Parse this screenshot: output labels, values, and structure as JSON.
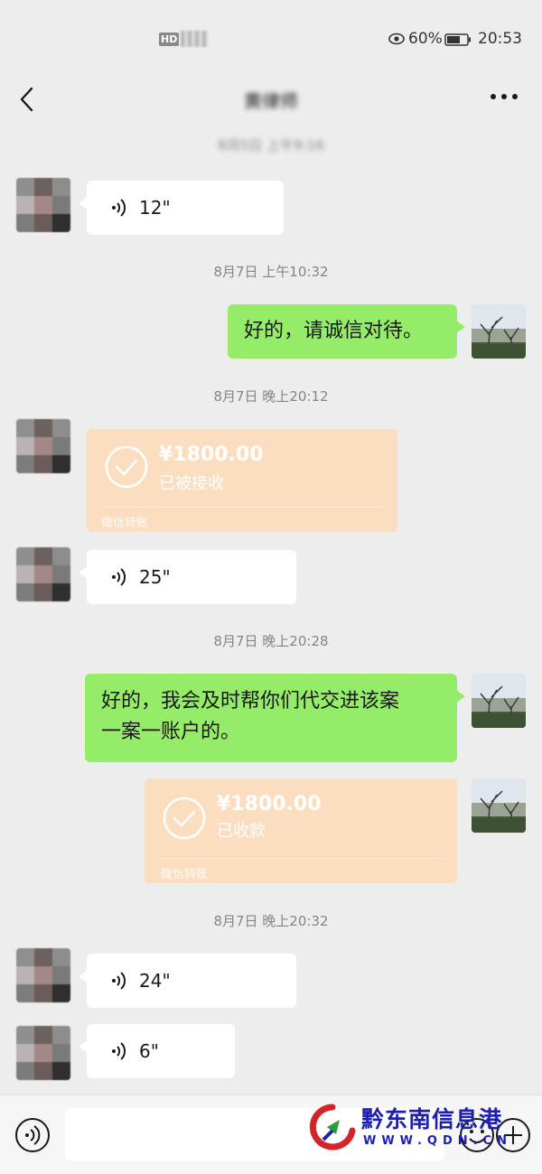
{
  "status_bar": {
    "hd_label": "HD",
    "battery_percent": "60%",
    "time": "20:53"
  },
  "nav": {
    "title": "黄律师"
  },
  "messages": {
    "ts_top": "8月5日 上午9:16",
    "voice1_duration": "12\"",
    "ts1": "8月7日 上午10:32",
    "text1": "好的，请诚信对待。",
    "ts2": "8月7日 晚上20:12",
    "transfer1": {
      "amount": "¥1800.00",
      "status": "已被接收",
      "footer": "微信转账"
    },
    "voice2_duration": "25\"",
    "ts3": "8月7日 晚上20:28",
    "text2_line1": "好的，我会及时帮你们代交进该案",
    "text2_line2": "一案一账户的。",
    "transfer2": {
      "amount": "¥1800.00",
      "status": "已收款",
      "footer": "微信转账"
    },
    "ts4": "8月7日 晚上20:32",
    "voice3_duration": "24\"",
    "voice4_duration": "6\""
  },
  "watermark": {
    "cn": "黔东南信息港",
    "en": "WWW.QDN.CN"
  },
  "colors": {
    "green_bubble": "#95ec69",
    "transfer_bg": "#fbdebf",
    "background": "#ededed"
  }
}
